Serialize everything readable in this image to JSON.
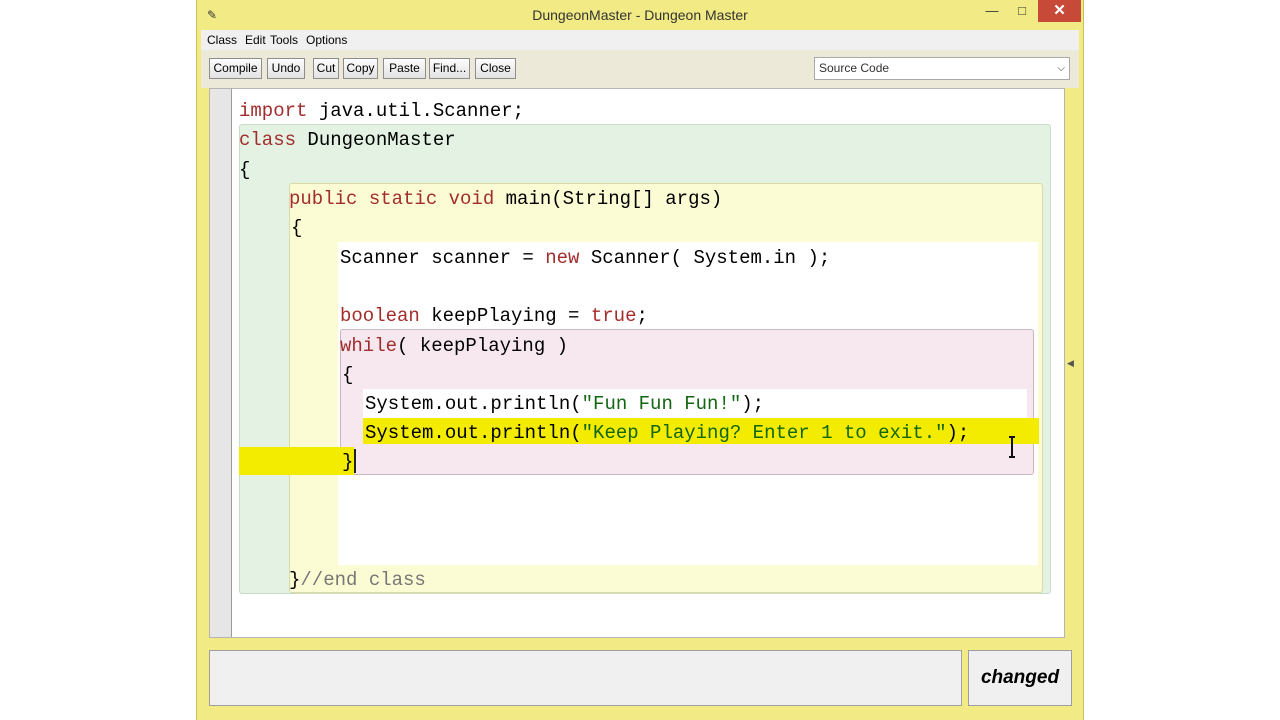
{
  "window": {
    "title": "DungeonMaster - Dungeon Master",
    "icon": "bluej-icon",
    "controls": {
      "minimize": "—",
      "maximize": "□",
      "close": "✕"
    }
  },
  "menu": [
    "Class",
    "Edit",
    "Tools",
    "Options"
  ],
  "toolbar": {
    "buttons": [
      "Compile",
      "Undo",
      "Cut",
      "Copy",
      "Paste",
      "Find...",
      "Close"
    ],
    "view_select": "Source Code"
  },
  "code": {
    "import_kw": "import",
    "import_rest": " java.util.Scanner;",
    "class_kw": "class",
    "class_name": " DungeonMaster",
    "class_open": "{",
    "method_kw": "public static void",
    "method_sig": " main(String[] args)",
    "method_open": "{",
    "scanner_a": "Scanner scanner = ",
    "scanner_kw": "new",
    "scanner_b": " Scanner( System.in );",
    "bool_kw": "boolean",
    "bool_mid": " keepPlaying = ",
    "bool_val": "true",
    "bool_end": ";",
    "while_kw": "while",
    "while_rest": "( keepPlaying )",
    "while_open": "{",
    "print1_a": "System.out.println(",
    "print1_str": "\"Fun Fun Fun!\"",
    "print1_b": ");",
    "print2_a": "System.out.println(",
    "print2_str": "\"Keep Playing? Enter 1 to exit.\"",
    "print2_b": ");",
    "while_close": "}",
    "class_close": "}",
    "end_comment": "//end class"
  },
  "status": {
    "message": "",
    "changed": "changed"
  },
  "colors": {
    "window": "#f2ea84",
    "keyword": "#a32d2d",
    "string": "#116611",
    "highlight": "#f3eb00"
  }
}
